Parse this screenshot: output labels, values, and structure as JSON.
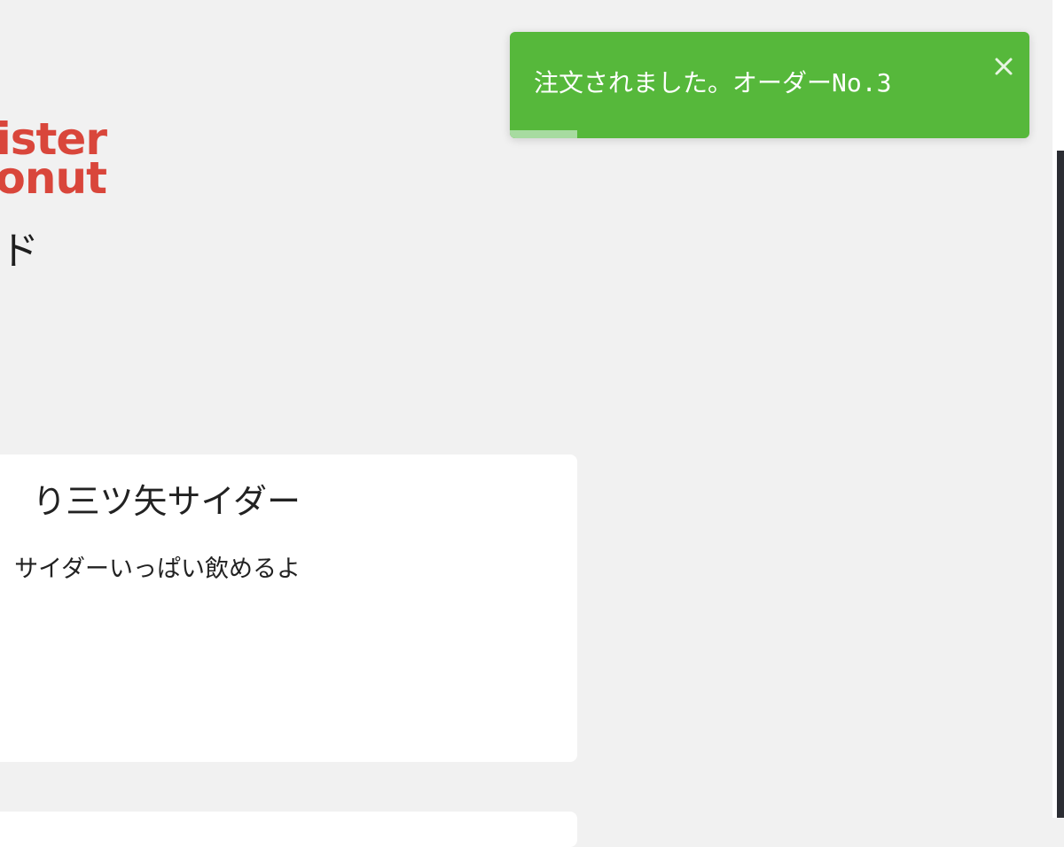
{
  "logo": {
    "line1": "Mister",
    "line2": "Donut",
    "color": "#d9463b"
  },
  "section": {
    "title": "ド"
  },
  "product": {
    "name": "り三ツ矢サイダー",
    "description": "サイダーいっぱい飲めるよ"
  },
  "toast": {
    "message": "注文されました。オーダーNo.3",
    "close_icon": "close-icon",
    "progress": 0.13,
    "background_color": "#56b83b"
  },
  "colors": {
    "page_background": "#f1f1f1",
    "card_background": "#ffffff"
  }
}
